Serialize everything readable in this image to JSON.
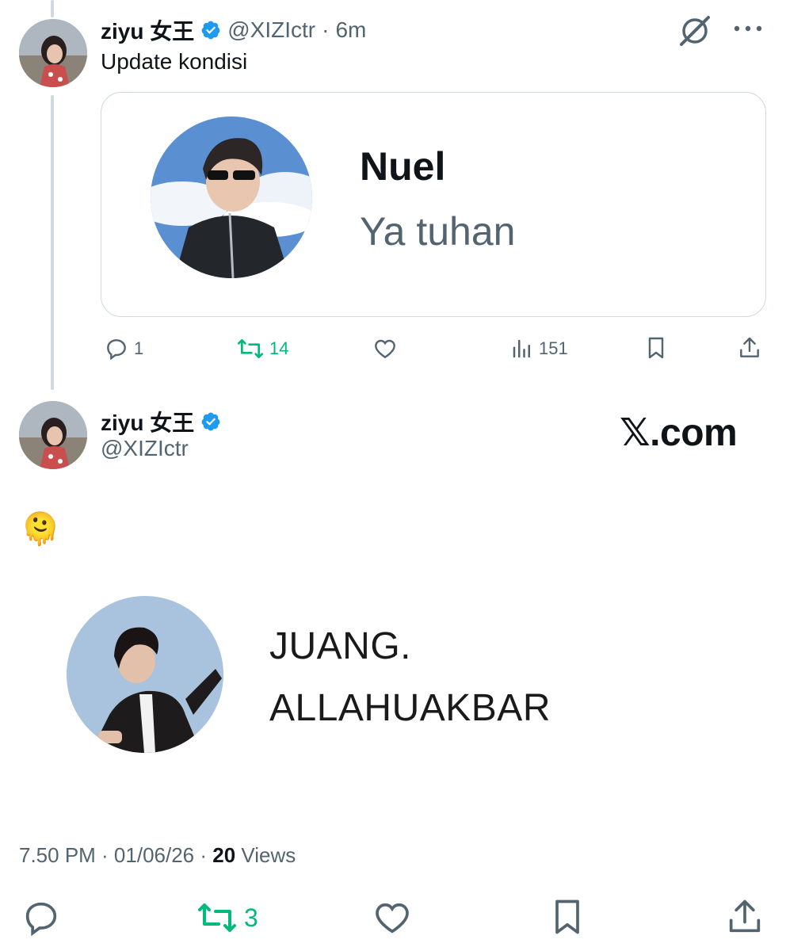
{
  "tweet1": {
    "display_name": "ziyu 女王",
    "handle": "@XIZIctr",
    "separator": "·",
    "time": "6m",
    "text": "Update kondisi",
    "quote": {
      "name": "Nuel",
      "message": "Ya tuhan"
    },
    "actions": {
      "replies": "1",
      "reposts": "14",
      "views": "151"
    }
  },
  "tweet2": {
    "display_name": "ziyu 女王",
    "handle": "@XIZIctr",
    "brand": "𝕏.com",
    "emoji": "🫠",
    "card_lines": [
      "JUANG.",
      "ALLAHUAKBAR"
    ],
    "meta_time": "7.50 PM · 01/06/26 · ",
    "meta_views_count": "20",
    "meta_views_label": " Views",
    "actions": {
      "reposts": "3"
    }
  },
  "colors": {
    "verified": "#1d9bf0",
    "repost_active": "#00ba7c",
    "muted": "#536471",
    "border": "#cfd9de"
  }
}
